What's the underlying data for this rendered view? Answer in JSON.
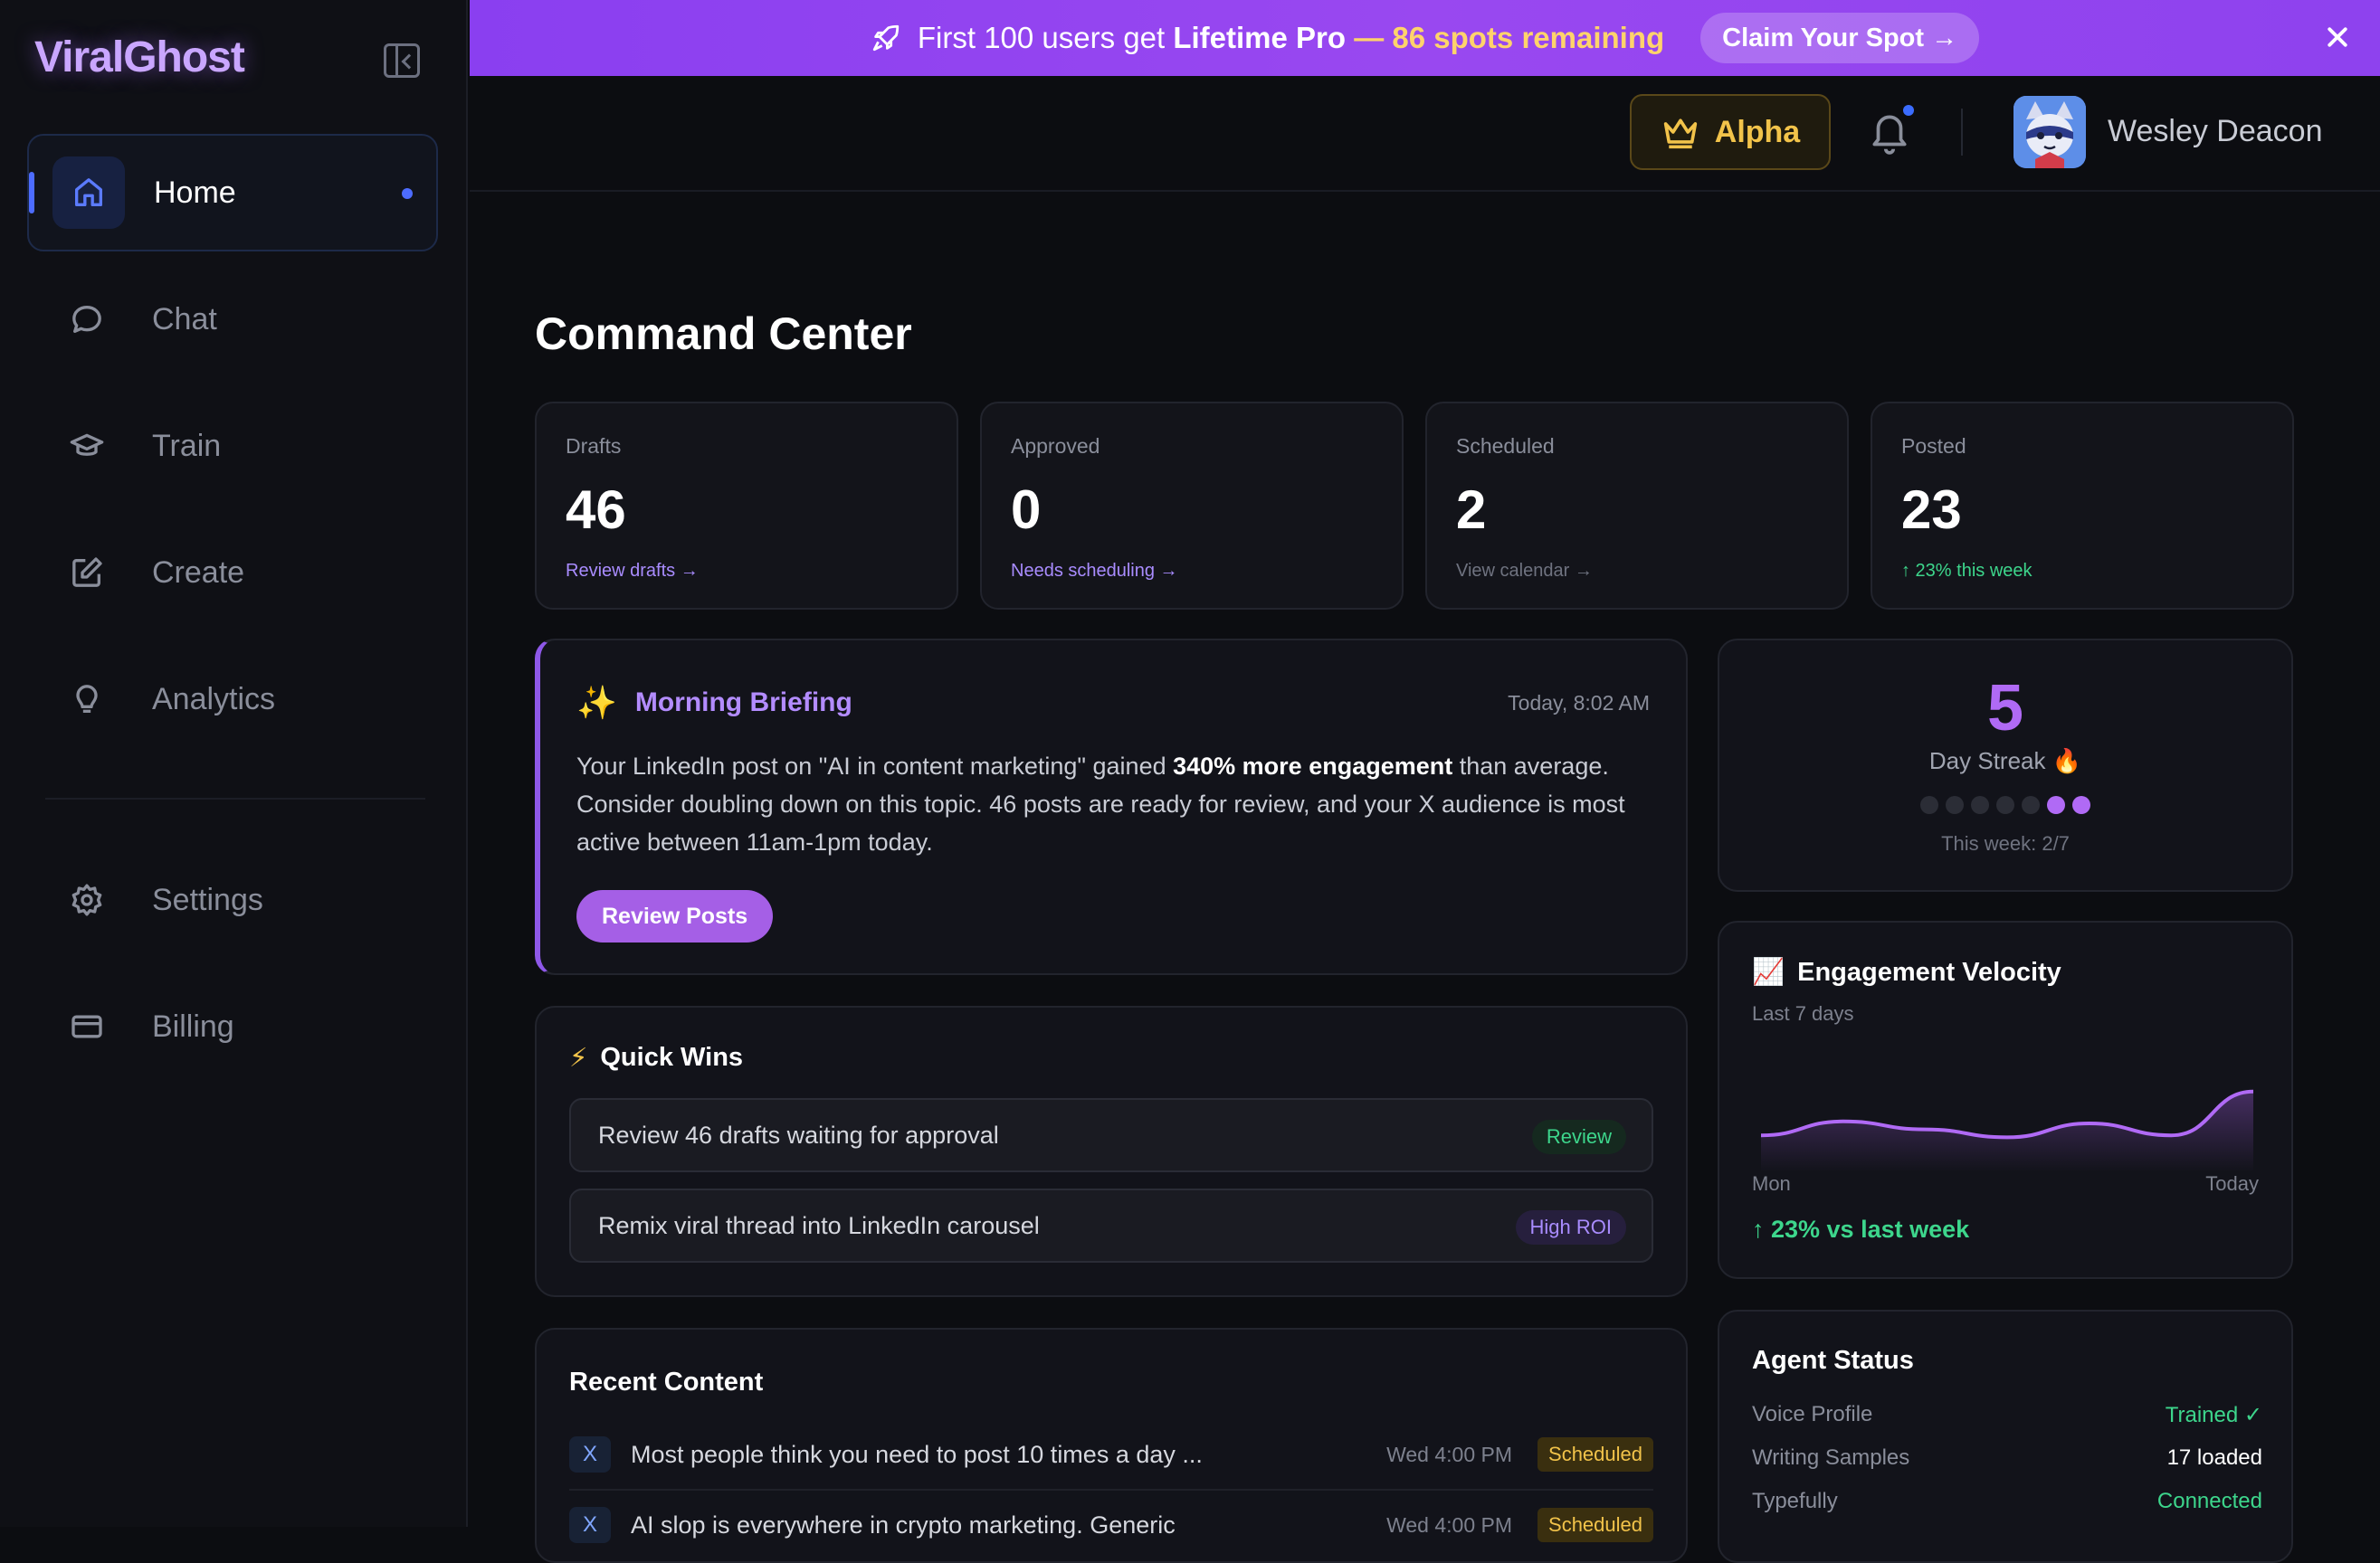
{
  "app": {
    "name": "ViralGhost"
  },
  "sidebar": {
    "items": [
      {
        "label": "Home",
        "icon": "home-icon",
        "active": true
      },
      {
        "label": "Chat",
        "icon": "chat-icon"
      },
      {
        "label": "Train",
        "icon": "graduation-cap-icon"
      },
      {
        "label": "Create",
        "icon": "edit-icon"
      },
      {
        "label": "Analytics",
        "icon": "lightbulb-icon"
      },
      {
        "label": "Settings",
        "icon": "gear-icon"
      },
      {
        "label": "Billing",
        "icon": "credit-card-icon"
      }
    ]
  },
  "banner": {
    "text_prefix": "First 100 users get ",
    "text_bold": "Lifetime Pro",
    "text_highlight": " — 86 spots remaining",
    "cta": "Claim Your Spot →"
  },
  "header": {
    "plan_badge": "Alpha",
    "user_name": "Wesley Deacon"
  },
  "main": {
    "title": "Command Center",
    "stats": [
      {
        "label": "Drafts",
        "value": "46",
        "link": "Review drafts →",
        "color": "#a98cff"
      },
      {
        "label": "Approved",
        "value": "0",
        "link": "Needs scheduling →",
        "color": "#a98cff"
      },
      {
        "label": "Scheduled",
        "value": "2",
        "link": "View calendar →",
        "color": "#6f7380"
      },
      {
        "label": "Posted",
        "value": "23",
        "link": "↑ 23% this week",
        "color": "#3dd68c"
      }
    ],
    "briefing": {
      "title": "Morning Briefing",
      "time": "Today, 8:02 AM",
      "text_before": "Your LinkedIn post on \"AI in content marketing\" gained ",
      "text_bold": "340% more engagement",
      "text_after": " than average. Consider doubling down on this topic. 46 posts are ready for review, and your X audience is most active between 11am-1pm today.",
      "button": "Review Posts"
    },
    "quick_wins": {
      "title": "Quick Wins",
      "items": [
        {
          "text": "Review 46 drafts waiting for approval",
          "tag": "Review",
          "tag_color": "#3dd68c"
        },
        {
          "text": "Remix viral thread into LinkedIn carousel",
          "tag": "High ROI",
          "tag_color": "#a98cff"
        }
      ]
    },
    "recent": {
      "title": "Recent Content",
      "rows": [
        {
          "platform": "X",
          "text": "Most people think you need to post 10 times a day ...",
          "time": "Wed 4:00 PM",
          "status": "Scheduled"
        },
        {
          "platform": "X",
          "text": "AI slop is everywhere in crypto marketing. Generic",
          "time": "Wed 4:00 PM",
          "status": "Scheduled"
        }
      ]
    }
  },
  "streak": {
    "value": "5",
    "label": "Day Streak 🔥",
    "week_text": "This week: 2/7",
    "days": [
      false,
      false,
      false,
      false,
      false,
      true,
      true
    ]
  },
  "velocity": {
    "title": "Engagement Velocity",
    "subtitle": "Last 7 days",
    "start_label": "Mon",
    "end_label": "Today",
    "change": "↑ 23% vs last week",
    "points": [
      0.28,
      0.42,
      0.34,
      0.26,
      0.4,
      0.28,
      0.72
    ]
  },
  "agent_status": {
    "title": "Agent Status",
    "rows": [
      {
        "label": "Voice Profile",
        "value": "Trained ✓",
        "color": "#3dd68c"
      },
      {
        "label": "Writing Samples",
        "value": "17 loaded",
        "color": "#ffffff"
      },
      {
        "label": "Typefully",
        "value": "Connected",
        "color": "#3dd68c"
      }
    ]
  },
  "colors": {
    "accent": "#a55fe6",
    "brand_purple": "#8e58e8",
    "gold": "#f2c34a",
    "green": "#3dd68c"
  }
}
